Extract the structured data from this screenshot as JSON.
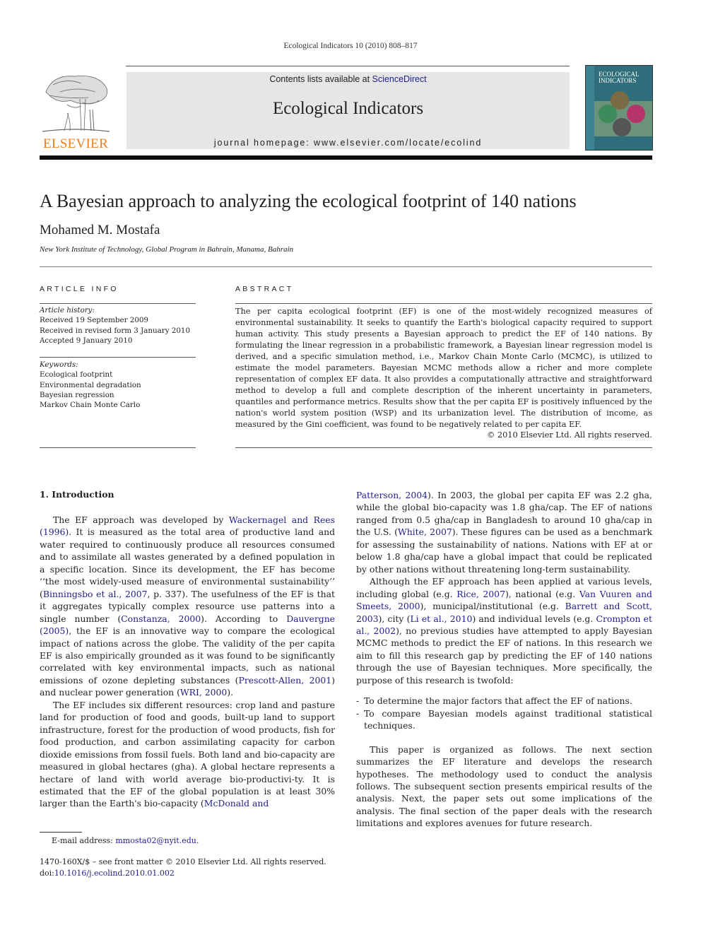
{
  "header": {
    "running_head": "Ecological Indicators 10 (2010) 808–817",
    "contents_prefix": "Contents lists available at ",
    "contents_link": "ScienceDirect",
    "journal_title": "Ecological Indicators",
    "homepage": "journal homepage: www.elsevier.com/locate/ecolind",
    "publisher_logo_text": "ELSEVIER",
    "publisher_color": "#f07d18",
    "link_color": "#1d1d8c",
    "cover_title_line1": "ECOLOGICAL",
    "cover_title_line2": "INDICATORS"
  },
  "article": {
    "title": "A Bayesian approach to analyzing the ecological footprint of 140 nations",
    "author": "Mohamed M. Mostafa",
    "affiliation": "New York Institute of Technology, Global Program in Bahrain, Manama, Bahrain"
  },
  "article_info": {
    "label": "ARTICLE INFO",
    "history_label": "Article history:",
    "history": [
      "Received 19 September 2009",
      "Received in revised form 3 January 2010",
      "Accepted 9 January 2010"
    ],
    "keywords_label": "Keywords:",
    "keywords": [
      "Ecological footprint",
      "Environmental degradation",
      "Bayesian regression",
      "Markov Chain Monte Carlo"
    ]
  },
  "abstract": {
    "label": "ABSTRACT",
    "text": "The per capita ecological footprint (EF) is one of the most-widely recognized measures of environmental sustainability. It seeks to quantify the Earth's biological capacity required to support human activity. This study presents a Bayesian approach to predict the EF of 140 nations. By formulating the linear regression in a probabilistic framework, a Bayesian linear regression model is derived, and a specific simulation method, i.e., Markov Chain Monte Carlo (MCMC), is utilized to estimate the model parameters. Bayesian MCMC methods allow a richer and more complete representation of complex EF data. It also provides a computationally attractive and straightforward method to develop a full and complete description of the inherent uncertainty in parameters, quantiles and performance metrics. Results show that the per capita EF is positively influenced by the nation's world system position (WSP) and its urbanization level. The distribution of income, as measured by the Gini coefficient, was found to be negatively related to per capita EF.",
    "copyright": "© 2010 Elsevier Ltd. All rights reserved."
  },
  "introduction": {
    "heading": "1.  Introduction",
    "p1": [
      {
        "t": "The EF approach was developed by "
      },
      {
        "ref": "Wackernagel and Rees (1996)"
      },
      {
        "t": ". It is measured as the total area of productive land and water required to continuously produce all resources consumed and to assimilate all wastes generated by a defined population in a specific location. Since its development, the EF has become ‘‘the most widely-used measure of environmental sustainability’’ ("
      },
      {
        "ref": "Binningsbo et al., 2007"
      },
      {
        "t": ", p. 337). The usefulness of the EF is that it aggregates typically complex resource use patterns into a single number ("
      },
      {
        "ref": "Constanza, 2000"
      },
      {
        "t": "). According to "
      },
      {
        "ref": "Dauvergne (2005)"
      },
      {
        "t": ", the EF is an innovative way to compare the ecological impact of nations across the globe. The validity of the per capita EF is also empirically grounded as it was found to be significantly correlated with key environmental impacts, such as national emissions of ozone depleting substances ("
      },
      {
        "ref": "Prescott-Allen, 2001"
      },
      {
        "t": ") and nuclear power generation ("
      },
      {
        "ref": "WRI, 2000"
      },
      {
        "t": ")."
      }
    ],
    "p2": [
      {
        "t": "The EF includes six different resources: crop land and pasture land for production of food and goods, built-up land to support infrastructure, forest for the production of wood products, fish for food production, and carbon assimilating capacity for carbon dioxide emissions from fossil fuels. Both land and bio-capacity are measured in global hectares (gha). A global hectare represents a hectare of land with world average bio-productivi-ty. It is estimated that the EF of the global population is at least 30% larger than the Earth's bio-capacity ("
      },
      {
        "ref": "McDonald and Patterson, 2004"
      },
      {
        "t": "). In 2003, the global per capita EF was 2.2 gha, while the global bio-capacity was 1.8 gha/cap. The EF of nations ranged from 0.5 gha/cap in Bangladesh to around 10 gha/cap in the U.S. ("
      },
      {
        "ref": "White, 2007"
      },
      {
        "t": "). These figures can be used as a benchmark for assessing the sustainability of nations. Nations with EF at or below 1.8 gha/cap have a global impact that could be replicated by other nations without threatening long-term sustainability."
      }
    ],
    "p3": [
      {
        "t": "Although the EF approach has been applied at various levels, including global (e.g. "
      },
      {
        "ref": "Rice, 2007"
      },
      {
        "t": "), national (e.g. "
      },
      {
        "ref": "Van Vuuren and Smeets, 2000"
      },
      {
        "t": "), municipal/institutional (e.g. "
      },
      {
        "ref": "Barrett and Scott, 2003"
      },
      {
        "t": "), city ("
      },
      {
        "ref": "Li et al., 2010"
      },
      {
        "t": ") and individual levels (e.g. "
      },
      {
        "ref": "Crompton et al., 2002"
      },
      {
        "t": "), no previous studies have attempted to apply Bayesian MCMC methods to predict the EF of nations. In this research we aim to fill this research gap by predicting the EF of 140 nations through the use of Bayesian techniques. More specifically, the purpose of this research is twofold:"
      }
    ],
    "bullets": [
      "To determine the major factors that affect the EF of nations.",
      "To compare Bayesian models against traditional statistical techniques."
    ],
    "p4": "This paper is organized as follows. The next section summarizes the EF literature and develops the research hypotheses. The methodology used to conduct the analysis follows. The subsequent section presents empirical results of the analysis. Next, the paper sets out some implications of the analysis. The final section of the paper deals with the research limitations and explores avenues for future research."
  },
  "footnote": {
    "email_label": "E-mail address: ",
    "email": "mmosta02@nyit.edu",
    "email_suffix": ".",
    "front_matter": "1470-160X/$ – see front matter © 2010 Elsevier Ltd. All rights reserved.",
    "doi_label": "doi:",
    "doi": "10.1016/j.ecolind.2010.01.002"
  }
}
